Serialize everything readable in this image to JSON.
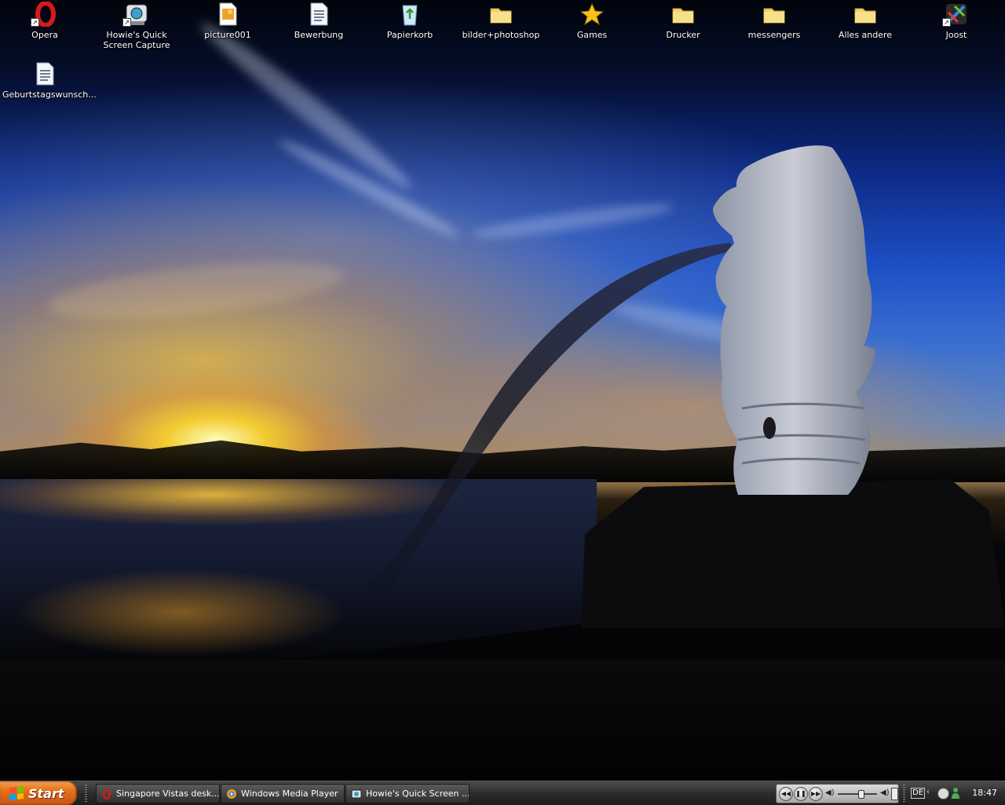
{
  "desktop_icons": [
    {
      "label": "Opera",
      "icon": "opera-icon",
      "shortcut": true
    },
    {
      "label": "Howie's Quick Screen Capture",
      "icon": "camera-app-icon",
      "shortcut": true
    },
    {
      "label": "picture001",
      "icon": "image-file-icon",
      "shortcut": false
    },
    {
      "label": "Bewerbung",
      "icon": "document-icon",
      "shortcut": false
    },
    {
      "label": "Papierkorb",
      "icon": "recycle-bin-icon",
      "shortcut": false
    },
    {
      "label": "bilder+photoshop",
      "icon": "folder-icon",
      "shortcut": false
    },
    {
      "label": "Games",
      "icon": "star-icon",
      "shortcut": false
    },
    {
      "label": "Drucker",
      "icon": "folder-icon",
      "shortcut": false
    },
    {
      "label": "messengers",
      "icon": "folder-icon",
      "shortcut": false
    },
    {
      "label": "Alles andere",
      "icon": "folder-icon",
      "shortcut": false
    },
    {
      "label": "Joost",
      "icon": "joost-icon",
      "shortcut": true
    },
    {
      "label": "Geburtstagswunsch...",
      "icon": "document-icon",
      "shortcut": false
    }
  ],
  "taskbar": {
    "start_label": "Start",
    "tasks": [
      {
        "label": "Singapore Vistas desk...",
        "icon": "opera-icon"
      },
      {
        "label": "Windows Media Player",
        "icon": "media-player-icon"
      },
      {
        "label": "Howie's Quick Screen ...",
        "icon": "camera-app-icon"
      }
    ],
    "language": "DE",
    "clock": "18:47"
  },
  "colors": {
    "start_button": "#e4701a",
    "taskbar": "#2c2c2c",
    "folder": "#f1d36a"
  }
}
